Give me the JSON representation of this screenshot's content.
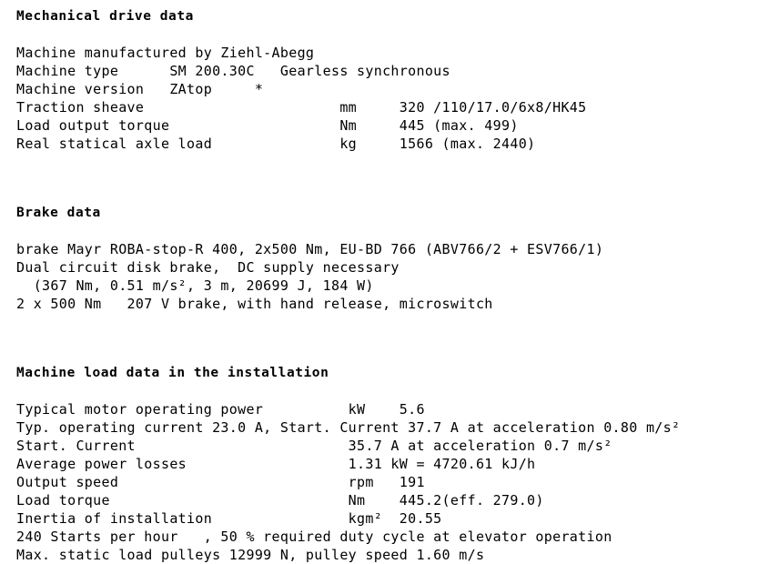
{
  "document": {
    "title": "Mechanical drive data",
    "background_color": "#ffffff",
    "text_color": "#000000"
  },
  "sections": [
    {
      "id": "mechanical-drive-data",
      "heading": "Mechanical drive data",
      "lines": [
        "Machine manufactured by Ziehl-Abegg",
        "Machine type      SM 200.30C   Gearless synchronous",
        "Machine version   ZAtop     *",
        "Traction sheave                       mm     320 /110/17.0/6x8/HK45",
        "Load output torque                    Nm     445 (max. 499)",
        "Real statical axle load               kg     1566 (max. 2440)"
      ],
      "fields": [
        {
          "label": "Machine manufactured by",
          "value": "Ziehl-Abegg",
          "unit": ""
        },
        {
          "label": "Machine type",
          "value": "SM 200.30C   Gearless synchronous",
          "unit": ""
        },
        {
          "label": "Machine version",
          "value": "ZAtop     *",
          "unit": ""
        },
        {
          "label": "Traction sheave",
          "unit": "mm",
          "value": "320 /110/17.0/6x8/HK45"
        },
        {
          "label": "Load output torque",
          "unit": "Nm",
          "value": "445 (max. 499)"
        },
        {
          "label": "Real statical axle load",
          "unit": "kg",
          "value": "1566 (max. 2440)"
        }
      ]
    },
    {
      "id": "brake-data",
      "heading": "Brake data",
      "lines": [
        "brake Mayr ROBA-stop-R 400, 2x500 Nm, EU-BD 766 (ABV766/2 + ESV766/1)",
        "Dual circuit disk brake,  DC supply necessary",
        "  (367 Nm, 0.51 m/s², 3 m, 20699 J, 184 W)",
        "2 x 500 Nm   207 V brake, with hand release, microswitch"
      ]
    },
    {
      "id": "machine-load-data",
      "heading": "Machine load data in the installation",
      "lines": [
        "Typical motor operating power          kW    5.6",
        "Typ. operating current 23.0 A, Start. Current 37.7 A at acceleration 0.80 m/s²",
        "Start. Current                         35.7 A at acceleration 0.7 m/s²",
        "Average power losses                   1.31 kW = 4720.61 kJ/h",
        "Output speed                           rpm   191",
        "Load torque                            Nm    445.2(eff. 279.0)",
        "Inertia of installation                kgm²  20.55",
        "240 Starts per hour   , 50 % required duty cycle at elevator operation",
        "Max. static load pulleys 12999 N, pulley speed 1.60 m/s"
      ],
      "fields": [
        {
          "label": "Typical motor operating power",
          "unit": "kW",
          "value": "5.6"
        },
        {
          "label": "Typ. operating current",
          "value": "23.0 A, Start. Current 37.7 A at acceleration 0.80 m/s²"
        },
        {
          "label": "Start. Current",
          "value": "35.7 A at acceleration 0.7 m/s²"
        },
        {
          "label": "Average power losses",
          "value": "1.31 kW = 4720.61 kJ/h"
        },
        {
          "label": "Output speed",
          "unit": "rpm",
          "value": "191"
        },
        {
          "label": "Load torque",
          "unit": "Nm",
          "value": "445.2(eff. 279.0)"
        },
        {
          "label": "Inertia of installation",
          "unit": "kgm²",
          "value": "20.55"
        },
        {
          "label": "Starts per hour",
          "value": "240",
          "note": ", 50 % required duty cycle at elevator operation"
        },
        {
          "label": "Max. static load pulleys",
          "value": "12999 N, pulley speed 1.60 m/s"
        }
      ]
    }
  ]
}
